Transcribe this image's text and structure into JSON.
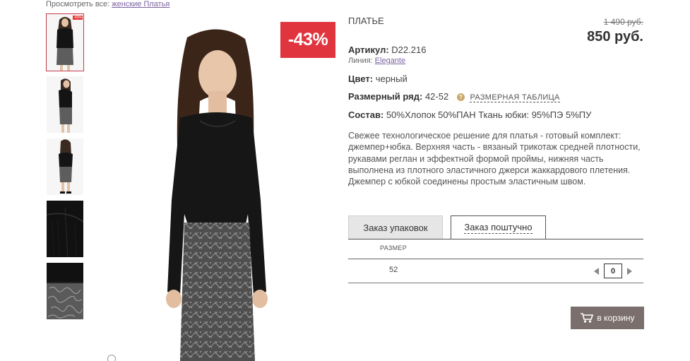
{
  "breadcrumb": {
    "prefix": "Просмотреть все:",
    "link": "женские Платья"
  },
  "gallery": {
    "thumbnail_badge": "-43%",
    "thumbnails": [
      "full-front",
      "side",
      "full-back",
      "shoulder-detail",
      "fabric-detail"
    ],
    "discount_badge": "-43%"
  },
  "product": {
    "title": "ПЛАТЬЕ",
    "old_price": "1 490 руб.",
    "price": "850 руб.",
    "article_label": "Артикул:",
    "article_value": "D22.216",
    "line_label": "Линия:",
    "line_value": "Elegante",
    "color_label": "Цвет:",
    "color_value": "черный",
    "size_label": "Размерный ряд:",
    "size_value": "42-52",
    "size_table_link": "РАЗМЕРНАЯ ТАБЛИЦА",
    "composition_label": "Состав:",
    "composition_value": "50%Хлопок 50%ПАН Ткань юбки: 95%ПЭ 5%ПУ",
    "description": "Свежее технологическое решение для платья - готовый комплект: джемпер+юбка. Верхняя часть - вязаный трикотаж средней плотности, рукавами реглан и эффектной формой проймы, нижняя часть выполнена из плотного эластичного джерси жаккардового плетения. Джемпер с юбкой соединены простым эластичным швом."
  },
  "order": {
    "tab_pack": "Заказ упаковок",
    "tab_single": "Заказ поштучно",
    "size_header": "РАЗМЕР",
    "rows": [
      {
        "size": "52",
        "quantity": "0"
      }
    ],
    "cart_button": "в корзину"
  },
  "colors": {
    "badge": "#e0353f",
    "link": "#7b62a0",
    "cart_button": "#7a6f6c",
    "help_icon": "#c9a96a"
  },
  "icons": [
    "question-icon",
    "arrow-left-icon",
    "arrow-right-icon",
    "cart-icon",
    "zoom-icon"
  ]
}
